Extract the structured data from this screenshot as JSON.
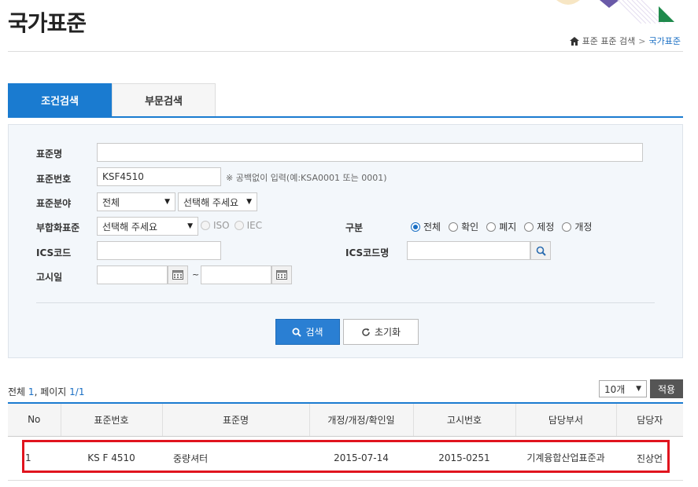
{
  "header": {
    "title": "국가표준",
    "breadcrumb": [
      "표준 표준 검색",
      "국가표준"
    ]
  },
  "tabs": [
    {
      "label": "조건검색",
      "active": true
    },
    {
      "label": "부문검색",
      "active": false
    }
  ],
  "form": {
    "standard_name": {
      "label": "표준명",
      "value": ""
    },
    "standard_number": {
      "label": "표준번호",
      "value": "KSF4510",
      "hint": "※ 공백없이 입력(예:KSA0001 또는 0001)"
    },
    "standard_field": {
      "label": "표준분야",
      "select1": "전체",
      "select2": "선택해 주세요"
    },
    "harmonized": {
      "label": "부합화표준",
      "select": "선택해 주세요",
      "options": [
        "ISO",
        "IEC"
      ]
    },
    "division": {
      "label": "구분",
      "options": [
        "전체",
        "확인",
        "폐지",
        "제정",
        "개정"
      ],
      "selected": "전체"
    },
    "ics_code": {
      "label": "ICS코드",
      "value": ""
    },
    "ics_code_name": {
      "label": "ICS코드명",
      "value": ""
    },
    "notice_date": {
      "label": "고시일",
      "from": "",
      "to": "",
      "separator": "~"
    }
  },
  "buttons": {
    "search": "검색",
    "reset": "초기화",
    "apply": "적용"
  },
  "summary": {
    "total_label": "전체",
    "total": "1",
    "page_label": ", 페이지",
    "page": "1/1"
  },
  "page_size": "10개",
  "table": {
    "columns": [
      "No",
      "표준번호",
      "표준명",
      "개정/개정/확인일",
      "고시번호",
      "담당부서",
      "담당자"
    ],
    "rows": [
      [
        "1",
        "KS F 4510",
        "중량셔터",
        "2015-07-14",
        "2015-0251",
        "기계융합산업표준과",
        "진상언"
      ]
    ]
  },
  "colors": {
    "accent": "#1a7bd0",
    "highlight": "#e0141e"
  }
}
